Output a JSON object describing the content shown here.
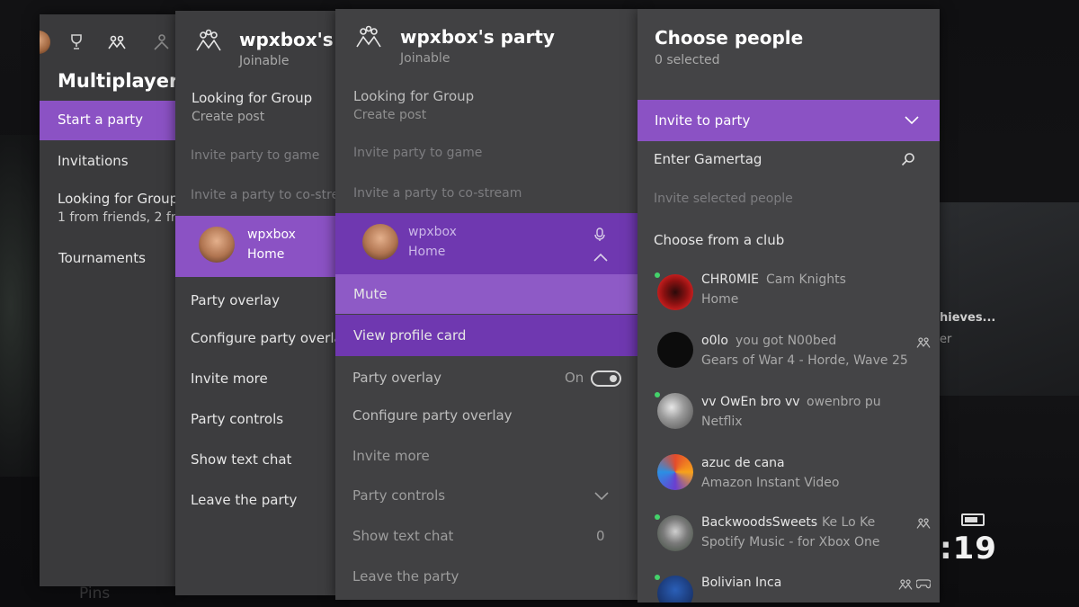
{
  "background": {
    "thieves_text": "hieves...",
    "ter_text": "er",
    "clock": ":19",
    "pins_text": "Pins"
  },
  "multiplayer": {
    "title": "Multiplayer",
    "items": [
      {
        "label": "Start a party"
      },
      {
        "label": "Invitations"
      },
      {
        "label": "Looking for Group",
        "sub": "1 from friends, 2 fr"
      },
      {
        "label": "Tournaments"
      }
    ]
  },
  "party_narrow": {
    "title": "wpxbox's",
    "status": "Joinable",
    "lfg_label": "Looking for Group",
    "lfg_sub": "Create post",
    "invite_game": "Invite party to game",
    "co_stream": "Invite a party to co-stre",
    "member_name": "wpxbox",
    "member_status": "Home",
    "party_overlay": "Party overlay",
    "configure_overlay": "Configure party overla",
    "invite_more": "Invite more",
    "party_controls": "Party controls",
    "show_text_chat": "Show text chat",
    "leave_party": "Leave the party"
  },
  "party_full": {
    "title": "wpxbox's party",
    "status": "Joinable",
    "lfg_label": "Looking for Group",
    "lfg_sub": "Create post",
    "invite_game": "Invite party to game",
    "co_stream": "Invite a party to co-stream",
    "member_name": "wpxbox",
    "member_status": "Home",
    "mute": "Mute",
    "view_profile": "View profile card",
    "party_overlay": "Party overlay",
    "overlay_state": "On",
    "configure_overlay": "Configure party overlay",
    "invite_more": "Invite more",
    "party_controls": "Party controls",
    "show_text_chat": "Show text chat",
    "text_chat_count": "0",
    "leave_party": "Leave the party"
  },
  "choose_people": {
    "title": "Choose people",
    "selected": "0 selected",
    "invite_to_party": "Invite to party",
    "enter_gamertag": "Enter Gamertag",
    "invite_selected": "Invite selected people",
    "choose_club": "Choose from a club",
    "friends": [
      {
        "gamertag": "CHR0MIE",
        "realname": "Cam Knights",
        "status": "Home"
      },
      {
        "gamertag": "o0lo",
        "realname": "you got N00bed",
        "status": "Gears of War 4 - Horde, Wave 25"
      },
      {
        "gamertag": "vv OwEn bro vv",
        "realname": "owenbro pu",
        "status": "Netflix"
      },
      {
        "gamertag": "azuc de cana",
        "realname": "",
        "status": "Amazon Instant Video"
      },
      {
        "gamertag": "BackwoodsSweets",
        "realname": "Ke Lo Ke",
        "status": "Spotify Music - for Xbox One"
      },
      {
        "gamertag": "Bolivian Inca",
        "realname": "",
        "status": ""
      }
    ]
  },
  "colors": {
    "accent": "#8b52c4",
    "accent_dark": "#6f38b0",
    "panel": "#414143",
    "online": "#44d26b"
  }
}
